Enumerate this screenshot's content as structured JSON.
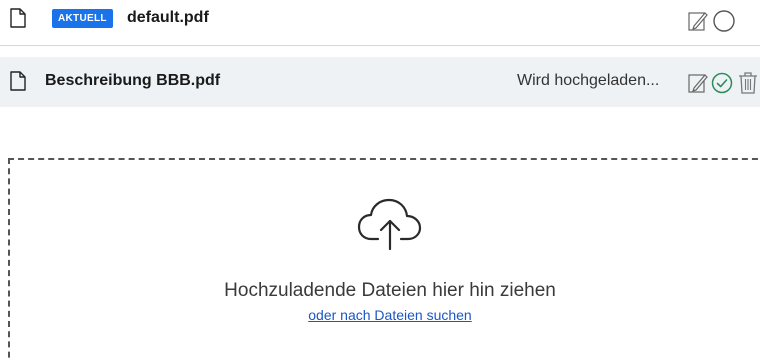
{
  "files": [
    {
      "name": "default.pdf",
      "badge": "AKTUELL",
      "status": ""
    },
    {
      "name": "Beschreibung BBB.pdf",
      "badge": "",
      "status": "Wird hochgeladen..."
    }
  ],
  "dropzone": {
    "instruction": "Hochzuladende Dateien hier hin ziehen",
    "browse_link": "oder nach Dateien suchen"
  },
  "colors": {
    "badge_bg": "#1a73e8",
    "selected_row_bg": "#eef2f5",
    "link": "#1a56c8",
    "check_green": "#2e8b57"
  },
  "icons": {
    "file": "file-icon",
    "edit": "pencil-edit-icon",
    "select": "circle-icon",
    "confirmed": "check-circle-icon",
    "delete": "trash-icon",
    "upload": "cloud-upload-icon"
  }
}
